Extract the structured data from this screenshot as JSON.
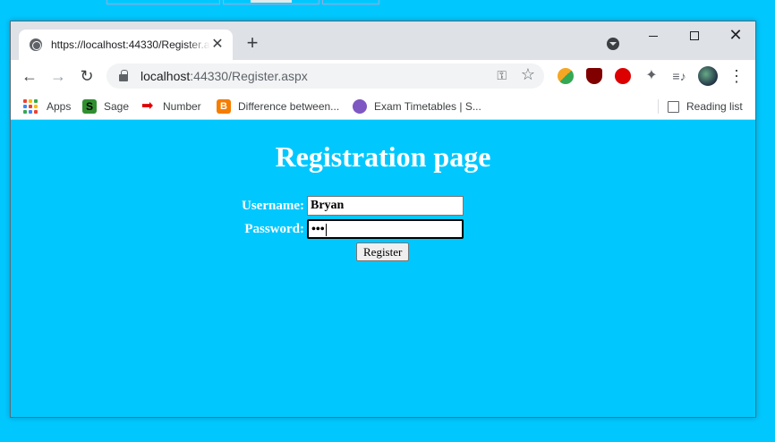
{
  "tab": {
    "title": "https://localhost:44330/Register.aspx",
    "close": "✕"
  },
  "toolbar": {
    "back": "←",
    "forward": "→",
    "reload": "↻",
    "url_host": "localhost",
    "url_path": ":44330/Register.aspx",
    "key_icon": "key-icon",
    "star_icon": "star-icon",
    "menu": "⋮",
    "puzzle": "✦",
    "playlist": "≡♪"
  },
  "window": {
    "minimize": "",
    "maximize": "",
    "close": "✕",
    "new_tab": "+"
  },
  "bookmarks": {
    "apps": "Apps",
    "sage": "Sage",
    "sage_icon": "S",
    "number": "Number",
    "difference": "Difference between...",
    "difference_icon": "B",
    "exam": "Exam Timetables | S...",
    "reading_list": "Reading list"
  },
  "page": {
    "title": "Registration page",
    "username_label": "Username:",
    "username_value": "Bryan",
    "password_label": "Password:",
    "password_value": "•••",
    "register_button": "Register"
  },
  "colors": {
    "page_background": "#00c8ff",
    "tabstrip": "#dee1e6",
    "apps_grid": [
      "#ea4335",
      "#fbbc05",
      "#34a853",
      "#4285f4",
      "#ea4335",
      "#fbbc05",
      "#34a853",
      "#4285f4",
      "#ea4335"
    ]
  }
}
